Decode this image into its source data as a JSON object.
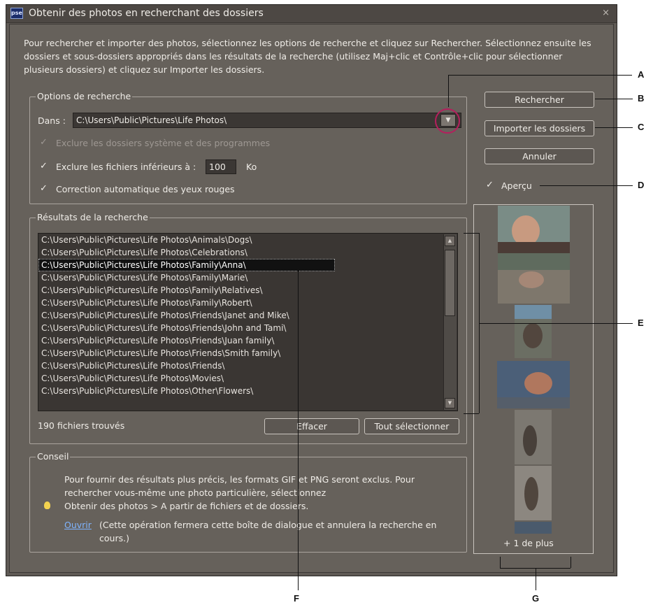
{
  "window": {
    "app_icon": "pse",
    "title": "Obtenir des photos en recherchant des dossiers",
    "close": "×"
  },
  "intro": "Pour rechercher et importer des photos, sélectionnez les options de recherche et cliquez sur Rechercher. Sélectionnez ensuite les dossiers et sous-dossiers appropriés dans les résultats de la recherche (utilisez Maj+clic et Contrôle+clic pour sélectionner plusieurs dossiers) et cliquez sur Importer les dossiers.",
  "search_options": {
    "legend": "Options de recherche",
    "dans_label": "Dans :",
    "dans_value": "C:\\Users\\Public\\Pictures\\Life Photos\\",
    "exclude_system_label": "Exclure les dossiers système et des programmes",
    "exclude_system_checked": true,
    "exclude_system_enabled": false,
    "exclude_small_label": "Exclure les fichiers inférieurs à :",
    "exclude_small_checked": true,
    "exclude_small_value": "100",
    "exclude_small_unit": "Ko",
    "redeye_label": "Correction automatique des yeux rouges",
    "redeye_checked": true
  },
  "buttons": {
    "search": "Rechercher",
    "import": "Importer les dossiers",
    "cancel": "Annuler",
    "clear": "Effacer",
    "select_all": "Tout sélectionner"
  },
  "preview": {
    "label": "Aperçu",
    "checked": true,
    "more": "+ 1 de plus"
  },
  "results": {
    "legend": "Résultats de la recherche",
    "items": [
      "C:\\Users\\Public\\Pictures\\Life Photos\\Animals\\Dogs\\",
      "C:\\Users\\Public\\Pictures\\Life Photos\\Celebrations\\",
      "C:\\Users\\Public\\Pictures\\Life Photos\\Family\\Anna\\",
      "C:\\Users\\Public\\Pictures\\Life Photos\\Family\\Marie\\",
      "C:\\Users\\Public\\Pictures\\Life Photos\\Family\\Relatives\\",
      "C:\\Users\\Public\\Pictures\\Life Photos\\Family\\Robert\\",
      "C:\\Users\\Public\\Pictures\\Life Photos\\Friends\\Janet and Mike\\",
      "C:\\Users\\Public\\Pictures\\Life Photos\\Friends\\John and Tami\\",
      "C:\\Users\\Public\\Pictures\\Life Photos\\Friends\\Juan family\\",
      "C:\\Users\\Public\\Pictures\\Life Photos\\Friends\\Smith family\\",
      "C:\\Users\\Public\\Pictures\\Life Photos\\Friends\\",
      "C:\\Users\\Public\\Pictures\\Life Photos\\Movies\\",
      "C:\\Users\\Public\\Pictures\\Life Photos\\Other\\Flowers\\"
    ],
    "selected_index": 2,
    "count_text": "190 fichiers trouvés"
  },
  "tip": {
    "legend": "Conseil",
    "icon": "lightbulb-icon",
    "line1": "Pour fournir des résultats plus précis, les formats GIF et PNG seront exclus. Pour",
    "line2": "rechercher vous-même une photo particulière, sélectionnez",
    "line3": "Obtenir des photos > A partir de fichiers et de dossiers.",
    "link": "Ouvrir",
    "link_note_1": "(Cette opération fermera cette boîte de dialogue et annulera la recherche en",
    "link_note_2": "cours.)"
  },
  "callouts": [
    "A",
    "B",
    "C",
    "D",
    "E",
    "F",
    "G"
  ],
  "colors": {
    "dialog_bg": "#66615b",
    "titlebar_bg": "#4d4844",
    "highlight_ring": "#b51f5d",
    "link": "#7fb4ff",
    "bulb": "#f3d24f"
  }
}
